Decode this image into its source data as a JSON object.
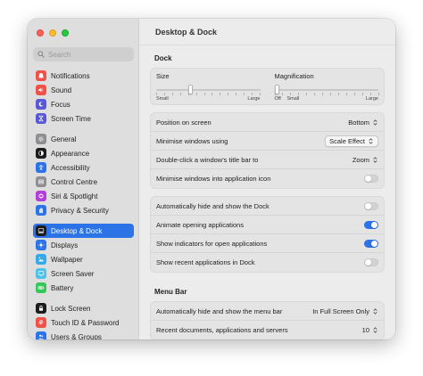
{
  "window": {
    "title": "Desktop & Dock"
  },
  "search": {
    "placeholder": "Search"
  },
  "sidebar": {
    "items": [
      {
        "label": "Notifications",
        "icon": "bell-icon",
        "color": "#f0524a"
      },
      {
        "label": "Sound",
        "icon": "speaker-icon",
        "color": "#f0524a"
      },
      {
        "label": "Focus",
        "icon": "moon-icon",
        "color": "#5b58d6"
      },
      {
        "label": "Screen Time",
        "icon": "hourglass-icon",
        "color": "#5b58d6"
      },
      {
        "label": "General",
        "icon": "gear-icon",
        "color": "#8e8e93"
      },
      {
        "label": "Appearance",
        "icon": "appearance-icon",
        "color": "#1c1c1e"
      },
      {
        "label": "Accessibility",
        "icon": "accessibility-icon",
        "color": "#2c73e8"
      },
      {
        "label": "Control Centre",
        "icon": "control-centre-icon",
        "color": "#8e8e93"
      },
      {
        "label": "Siri & Spotlight",
        "icon": "siri-icon",
        "color": "#b43fd6"
      },
      {
        "label": "Privacy & Security",
        "icon": "hand-icon",
        "color": "#2c73e8"
      },
      {
        "label": "Desktop & Dock",
        "icon": "dock-icon",
        "color": "#1c1c1e"
      },
      {
        "label": "Displays",
        "icon": "sun-icon",
        "color": "#2c73e8"
      },
      {
        "label": "Wallpaper",
        "icon": "wallpaper-icon",
        "color": "#36a9e8"
      },
      {
        "label": "Screen Saver",
        "icon": "screen-saver-icon",
        "color": "#4fc0e8"
      },
      {
        "label": "Battery",
        "icon": "battery-icon",
        "color": "#34c759"
      },
      {
        "label": "Lock Screen",
        "icon": "lock-icon",
        "color": "#1c1c1e"
      },
      {
        "label": "Touch ID & Password",
        "icon": "fingerprint-icon",
        "color": "#f0524a"
      },
      {
        "label": "Users & Groups",
        "icon": "users-icon",
        "color": "#2c73e8"
      }
    ]
  },
  "dock": {
    "section_title": "Dock",
    "size": {
      "label": "Size",
      "min_label": "Small",
      "max_label": "Large",
      "value": 0.32
    },
    "magnification": {
      "label": "Magnification",
      "off_label": "Off",
      "min_label": "Small",
      "max_label": "Large",
      "value": 0.0
    },
    "position": {
      "label": "Position on screen",
      "value": "Bottom"
    },
    "minimise_using": {
      "label": "Minimise windows using",
      "value": "Scale Effect"
    },
    "double_click": {
      "label": "Double-click a window's title bar to",
      "value": "Zoom"
    },
    "minimise_into_icon": {
      "label": "Minimise windows into application icon",
      "on": false
    },
    "auto_hide": {
      "label": "Automatically hide and show the Dock",
      "on": false
    },
    "animate": {
      "label": "Animate opening applications",
      "on": true
    },
    "indicators": {
      "label": "Show indicators for open applications",
      "on": true
    },
    "recent": {
      "label": "Show recent applications in Dock",
      "on": false
    }
  },
  "menubar": {
    "section_title": "Menu Bar",
    "auto_hide": {
      "label": "Automatically hide and show the menu bar",
      "value": "In Full Screen Only"
    },
    "recent_docs": {
      "label": "Recent documents, applications and servers",
      "value": "10"
    }
  },
  "colors": {
    "accent": "#2c73e8"
  }
}
